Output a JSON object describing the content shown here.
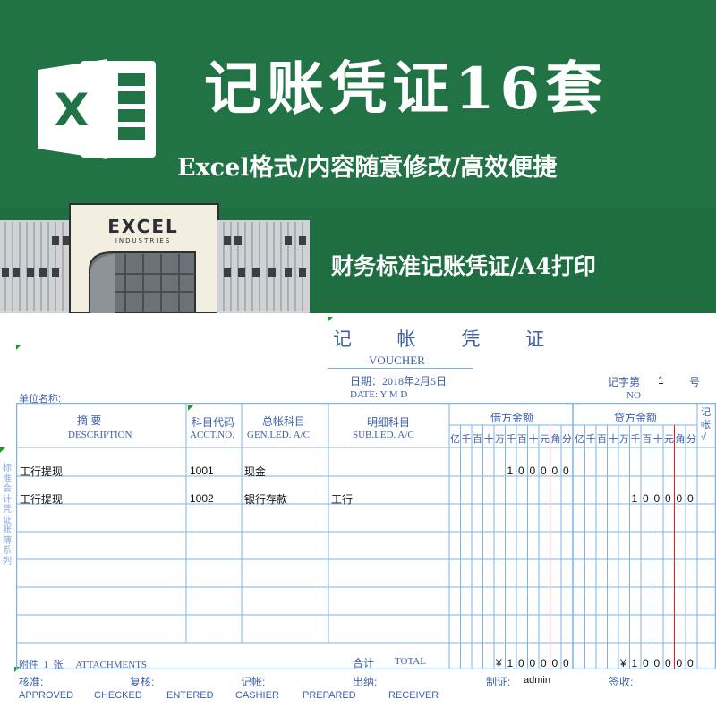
{
  "banner": {
    "title": "记账凭证16套",
    "subtitle": "Excel格式/内容随意修改/高效便捷",
    "tagline": "财务标准记账凭证/A4打印",
    "logo_letter": "X",
    "building_sign": "EXCEL",
    "building_subsign": "INDUSTRIES",
    "green": "#217346"
  },
  "voucher": {
    "title": "记 帐 凭 证",
    "title_en": "VOUCHER",
    "date": "日期：2018年2月5日",
    "date_en": "DATE:   Y   M   D",
    "voucher_no_label": "记字第",
    "voucher_no": "1",
    "voucher_no_suffix": "号",
    "no_label": "NO",
    "unit_label": "单位名称:",
    "side_text": "标准会计凭证账簿系列",
    "headers": {
      "summary": "摘    要",
      "summary_en": "DESCRIPTION",
      "acct_code": "科目代码",
      "acct_code_en": "ACCT.NO.",
      "gen_ledger": "总帐科目",
      "gen_ledger_en": "GEN.LED.  A/C",
      "sub_ledger": "明细科目",
      "sub_ledger_en": "SUB.LED.  A/C",
      "debit": "借方金额",
      "credit": "贷方金额",
      "posted": "记帐√",
      "digits": [
        "亿",
        "千",
        "百",
        "十",
        "万",
        "千",
        "百",
        "十",
        "元",
        "角",
        "分"
      ]
    },
    "rows": [
      {
        "summary": "工行提现",
        "acct": "1001",
        "gen": "现金",
        "sub": "",
        "debit": "100000",
        "credit": ""
      },
      {
        "summary": "工行提现",
        "acct": "1002",
        "gen": "银行存款",
        "sub": "工行",
        "debit": "",
        "credit": "100000"
      }
    ],
    "attachments": "附件  1  张     ATTACHMENTS",
    "total_label": "合计",
    "total_en": "TOTAL",
    "debit_total": "¥100000",
    "credit_total": "¥100000",
    "footer": {
      "approved": "核准:",
      "checked": "复核:",
      "entered": "记帐:",
      "cashier": "出纳:",
      "prepared": "制证:",
      "prepared_by": "admin",
      "receiver": "签收:",
      "approved_en": "APPROVED",
      "checked_en": "CHECKED",
      "entered_en": "ENTERED",
      "cashier_en": "CASHIER",
      "prepared_en": "PREPARED",
      "receiver_en": "RECEIVER"
    },
    "line_color": "#7fb3e6",
    "red_line": "#d81e1e"
  }
}
